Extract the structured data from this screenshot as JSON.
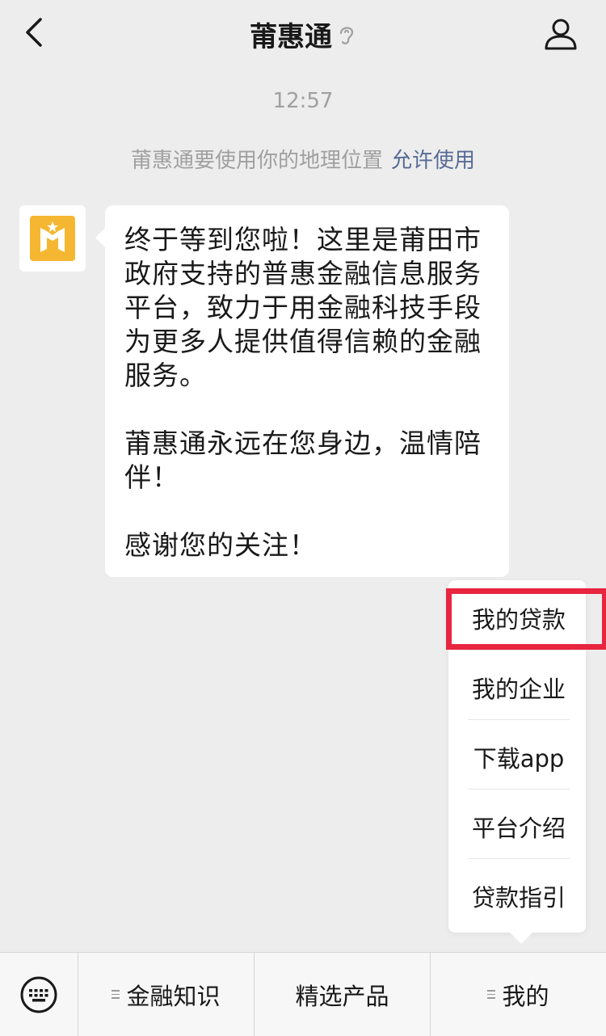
{
  "header": {
    "title": "莆惠通",
    "back_icon": "chevron-left-icon",
    "status_icon": "ear-icon",
    "profile_icon": "person-icon"
  },
  "chat": {
    "time": "12:57",
    "location_notice": "莆惠通要使用你的地理位置",
    "location_allow": "允许使用",
    "message": {
      "para1": "终于等到您啦！这里是莆田市政府支持的普惠金融信息服务平台，致力于用金融科技手段为更多人提供值得信赖的金融服务。",
      "para2": "莆惠通永远在您身边，温情陪伴！",
      "para3": "感谢您的关注！"
    }
  },
  "popup": {
    "items": [
      "我的贷款",
      "我的企业",
      "下载app",
      "平台介绍",
      "贷款指引"
    ]
  },
  "bottom_menu": {
    "keyboard_icon": "keyboard-icon",
    "items": [
      "金融知识",
      "精选产品",
      "我的"
    ]
  },
  "colors": {
    "background": "#ededed",
    "link": "#576b95",
    "highlight": "#e8263f",
    "logo": "#f5b731"
  }
}
